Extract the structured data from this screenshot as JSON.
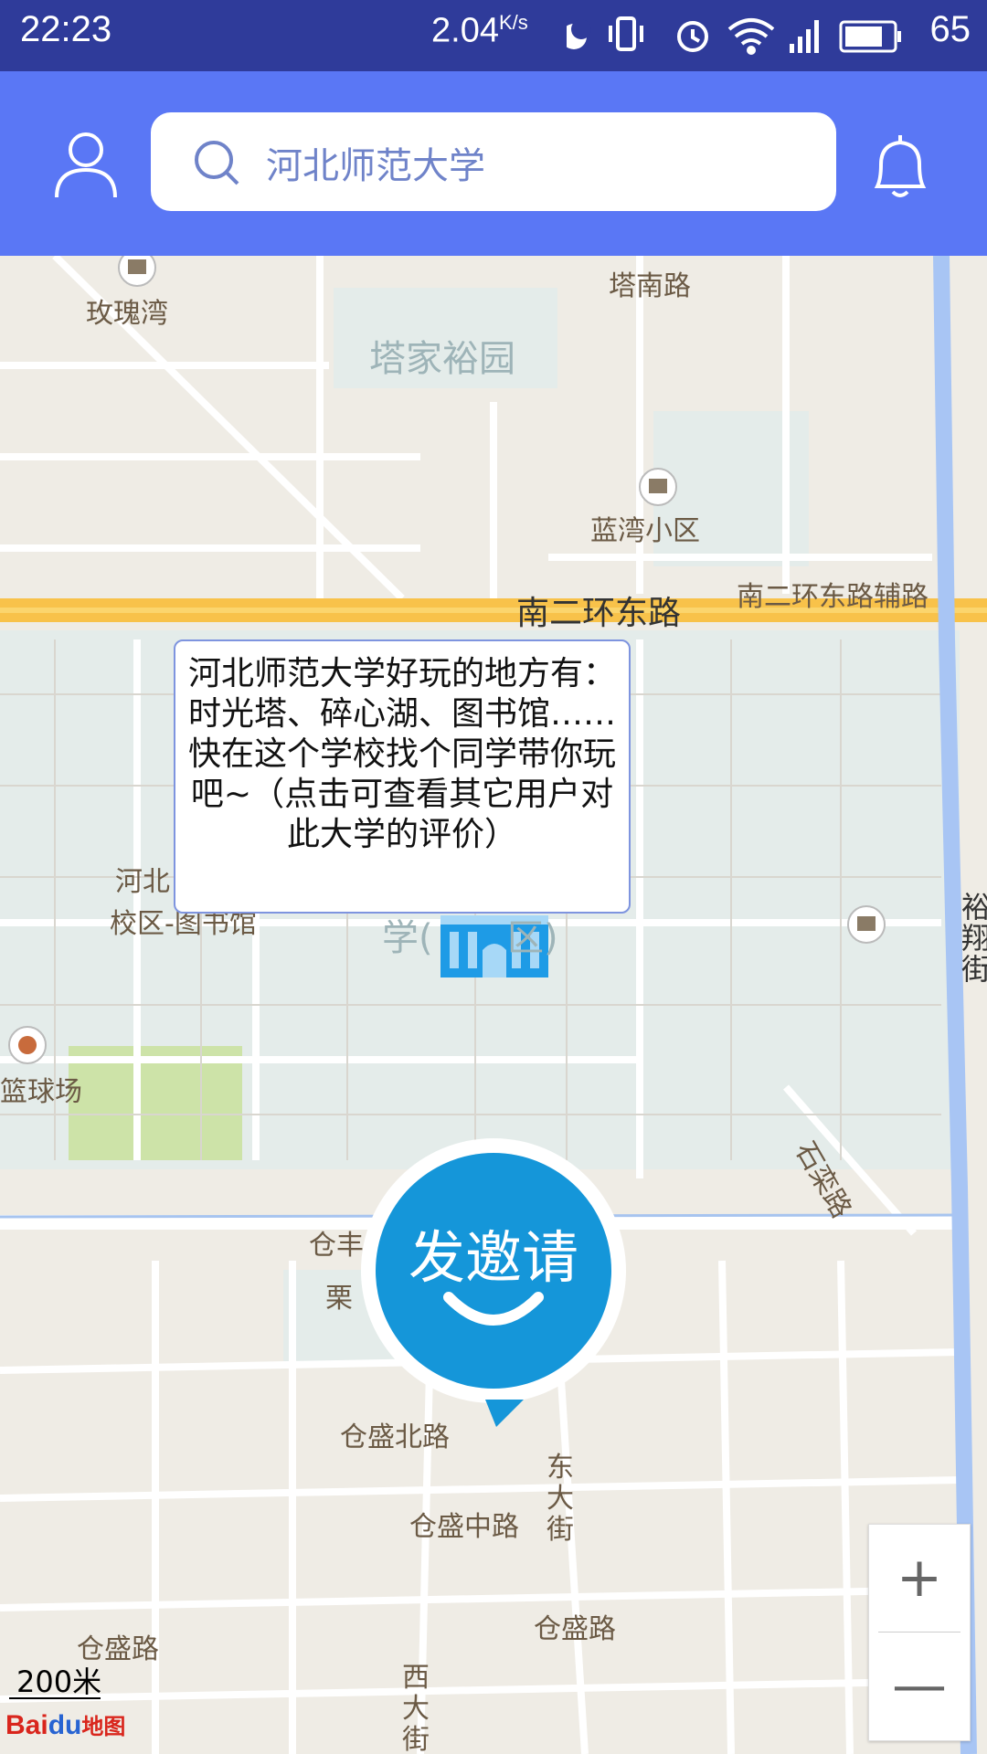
{
  "status_bar": {
    "time": "22:23",
    "speed": "2.04",
    "speed_unit": "K/s",
    "battery": "65",
    "icons": [
      "moon-icon",
      "vibrate-icon",
      "alarm-icon",
      "wifi-icon",
      "4g-signal-icon",
      "battery-icon"
    ]
  },
  "header": {
    "search_text": "河北师范大学",
    "colors": {
      "header_bg": "#5a77f5",
      "status_bg": "#2f3b9a"
    }
  },
  "map": {
    "labels": {
      "meigui": "玫瑰湾",
      "tanan": "塔南路",
      "tajia": "塔家裕园",
      "lanwan": "蓝湾小区",
      "nanerhuan": "南二环东路",
      "nanerhuan_fu": "南二环东路辅路",
      "hebei_lib_1": "河北",
      "hebei_lib_2": "校区-图书馆",
      "xue": "学(",
      "qu": "区)",
      "lanqiu": "篮球场",
      "shizhang": "石栾路",
      "cang_top": "仓丰",
      "li": "栗",
      "cangsheng_bei": "仓盛北路",
      "dongdajie": "东大街",
      "cangsheng_zhong": "仓盛中路",
      "cangsheng": "仓盛路",
      "cangsheng_left": "仓盛路",
      "xidajie": "西大街",
      "yu": "裕翔街"
    },
    "popup_text": "河北师范大学好玩的地方有：时光塔、碎心湖、图书馆……快在这个学校找个同学带你玩吧~（点击可查看其它用户对此大学的评价）",
    "invite_label": "发邀请",
    "zoom_in": "+",
    "zoom_out": "—",
    "scale": "200米",
    "logo_bai": "Bai",
    "logo_du": "du",
    "logo_map": "地图"
  }
}
